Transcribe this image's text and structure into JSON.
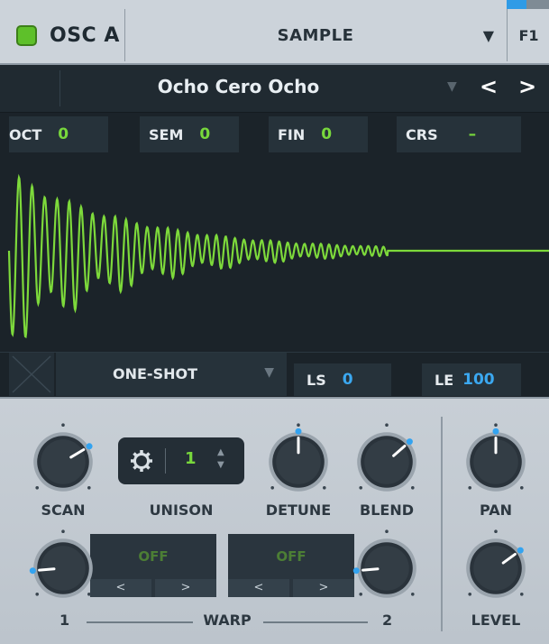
{
  "header": {
    "osc_label": "OSC A",
    "mode_label": "SAMPLE",
    "fx_label": "F1",
    "osc_enabled": true,
    "accent_color": "#5ec02a"
  },
  "preset": {
    "name": "Ocho Cero Ocho",
    "prev": "<",
    "next": ">"
  },
  "tuning": [
    {
      "label": "OCT",
      "value": "0"
    },
    {
      "label": "SEM",
      "value": "0"
    },
    {
      "label": "FIN",
      "value": "0"
    },
    {
      "label": "CRS",
      "value": "–"
    }
  ],
  "waveform": {
    "color": "#7dd93b",
    "shape": "decaying-oscillation"
  },
  "loop": {
    "mode": "ONE-SHOT",
    "ls_label": "LS",
    "ls_value": "0",
    "le_label": "LE",
    "le_value": "100"
  },
  "knobs": {
    "scan": {
      "label": "SCAN",
      "value": 0.72
    },
    "detune": {
      "label": "DETUNE",
      "value": 0.5
    },
    "blend": {
      "label": "BLEND",
      "value": 0.68
    },
    "pan": {
      "label": "PAN",
      "value": 0.5
    },
    "level": {
      "label": "LEVEL",
      "value": 0.7
    },
    "warp1": {
      "label": "1",
      "value": 0.15
    },
    "warp2": {
      "label": "2",
      "value": 0.15
    }
  },
  "unison": {
    "label": "UNISON",
    "value": "1"
  },
  "warp": {
    "label": "WARP",
    "slot1": "OFF",
    "slot2": "OFF",
    "left": "<",
    "right": ">"
  }
}
